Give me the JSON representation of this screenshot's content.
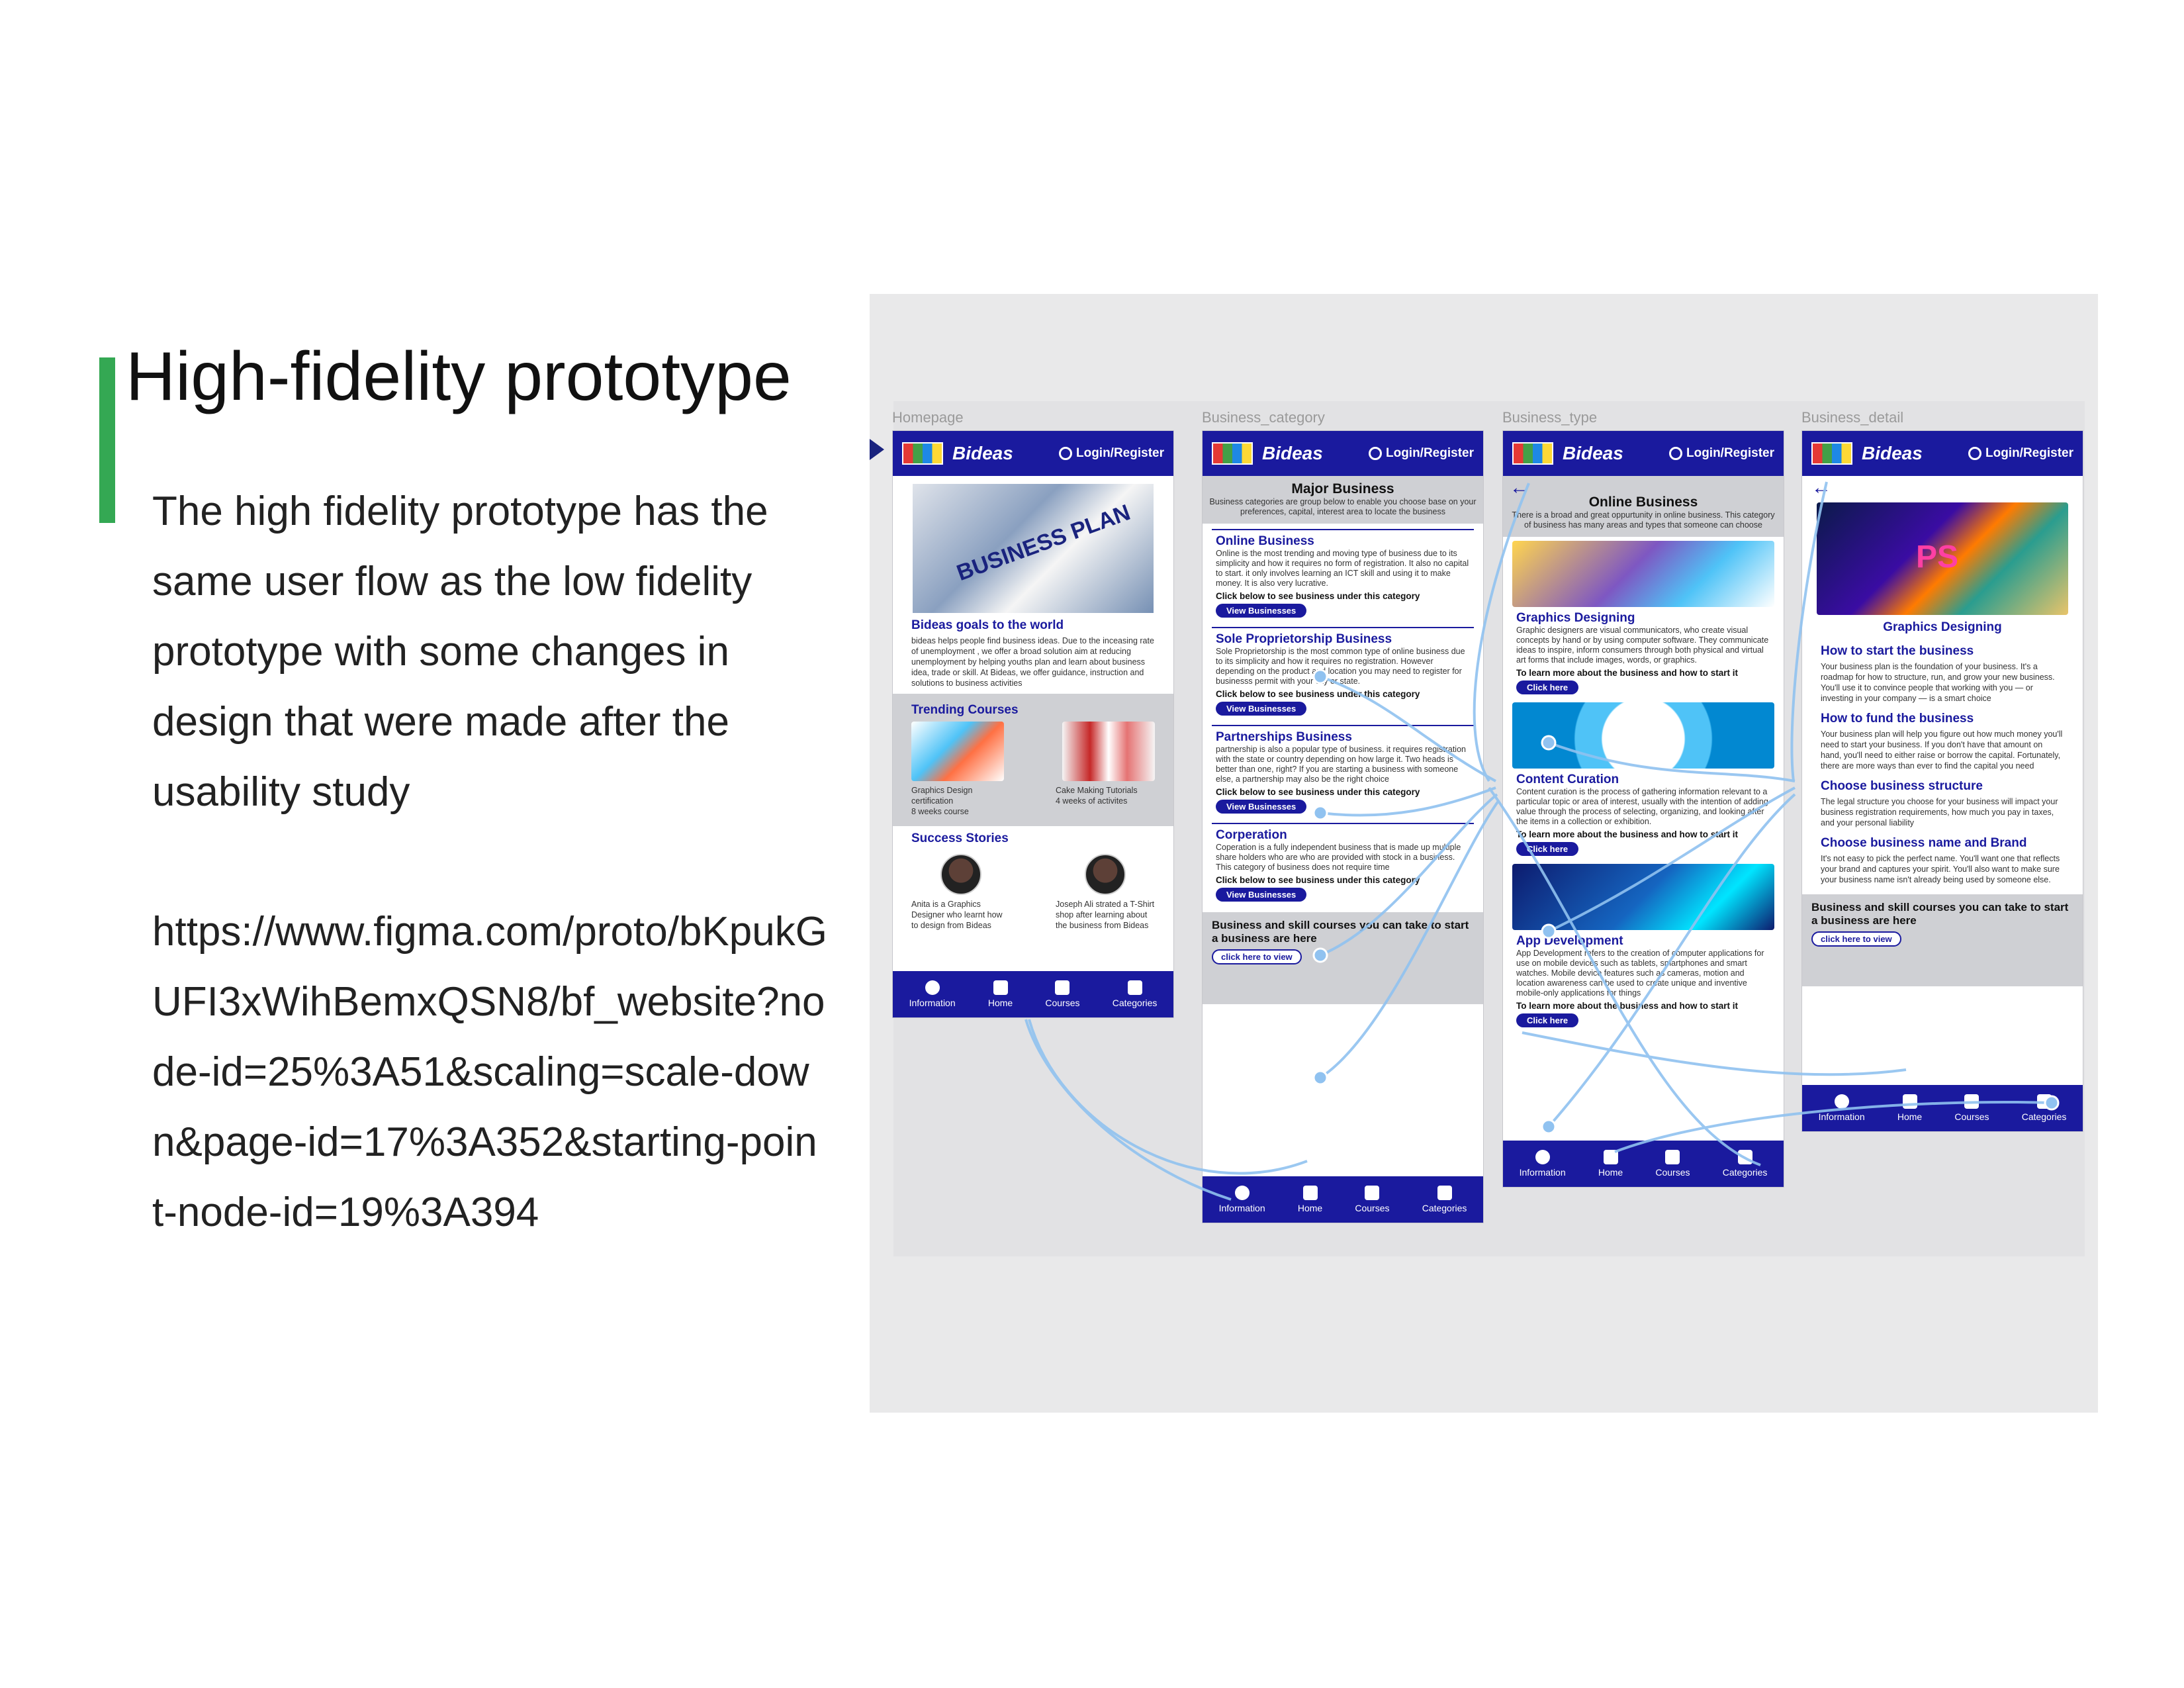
{
  "slide": {
    "title": "High-fidelity prototype",
    "body": "The high fidelity prototype has the same user flow as the low fidelity prototype with some changes in design that were made after the usability study",
    "link": "https://www.figma.com/proto/bKpukGUFI3xWihBemxQSN8/bf_website?node-id=25%3A51&scaling=scale-down&page-id=17%3A352&starting-point-node-id=19%3A394"
  },
  "colors": {
    "accent": "#34a853",
    "brand": "#1a1a9e",
    "canvas": "#e9e9ea"
  },
  "app": {
    "brand": "Bideas",
    "login": "Login/Register"
  },
  "frames": {
    "homepage": "Homepage",
    "business_category": "Business_category",
    "business_type": "Business_type",
    "business_detail": "Business_detail"
  },
  "tabbar": [
    "Information",
    "Home",
    "Courses",
    "Categories"
  ],
  "homepage": {
    "hero_text": "BUSINESS PLAN",
    "goals_title": "Bideas goals to the world",
    "goals_text": "bideas helps people find business ideas. Due to the inceasing rate of unemployment , we offer a broad solution aim at reducing unemployment by helping youths plan and learn about business idea, trade or skill. At Bideas, we offer guidance, instruction and solutions to business activities",
    "trending_title": "Trending Courses",
    "course1": "Graphics Design certification",
    "course1_meta": "8 weeks course",
    "course2": "Cake Making Tutorials",
    "course2_meta": "4 weeks of activites",
    "stories_title": "Success Stories",
    "story1": "Anita is a Graphics Designer who learnt how to design from Bideas",
    "story2": "Joseph Ali strated a T-Shirt shop after learning about the business from Bideas"
  },
  "category": {
    "title": "Major Business",
    "desc": "Business categories are group below to enable you choose base on your preferences, capital, interest area to locate the business",
    "cards": [
      {
        "title": "Online Business",
        "text": "Online is the most trending and moving type of business due to its simplicity and how it requires no form of registration. It also no capital to start. it only involves learning an ICT skill and using it to make money. It is also very lucrative."
      },
      {
        "title": "Sole Proprietorship Business",
        "text": "Sole Proprietorship is the most common type of online business due to its simplicity and how it requires no registration. However depending on the product and location you may need to register for businesss permit with your city or state."
      },
      {
        "title": "Partnerships Business",
        "text": "partnership is also a popular type of business. it requires registration with the state or country depending on how large it. Two heads is better than one, right? If you are starting a business with someone else, a partnership may also be the right choice"
      },
      {
        "title": "Corperation",
        "text": "Coperation is a fully independent business that is made up multiple share holders who are who are provided with stock in a business. This category of business does not require time"
      }
    ],
    "cta": "Click below to see  business under this category",
    "button": "View Businesses",
    "bottom_text": "Business and skill courses you can take to start a business are here",
    "bottom_button": "click here  to view"
  },
  "type": {
    "title": "Online Business",
    "desc": "There is a broad and great oppurtunity in online business. This category of business has many areas and types that someone can choose",
    "items": [
      {
        "title": "Graphics Designing",
        "text": "Graphic designers are visual communicators, who create visual concepts by hand or by using computer software. They communicate ideas to inspire, inform consumers through both physical and virtual art forms that include images, words, or graphics."
      },
      {
        "title": "Content Curation",
        "text": "Content curation is the process of gathering information relevant to a particular topic or area of interest, usually with the intention of adding value through the process of selecting, organizing, and looking after the items in a collection or exhibition."
      },
      {
        "title": "App Development",
        "text": "App Development refers to the creation of computer applications for use on mobile devices such as tablets, smartphones and smart watches. Mobile device features such as cameras, motion and location awareness can be used to create unique and inventive mobile-only applications for things"
      }
    ],
    "cta": "To learn more  about the business and how to start it",
    "button": "Click here"
  },
  "detail": {
    "image_text": "PS",
    "title": "Graphics Designing",
    "sections": [
      {
        "title": "How to start the business",
        "text": "Your business plan is the foundation of your business. It's a roadmap for how to structure, run, and grow your new business. You'll use it to convince people that working with you — or investing in your company — is a smart choice"
      },
      {
        "title": "How to fund the business",
        "text": "Your business plan will help you figure out how much money you'll need to start your business. If you don't have that amount on hand, you'll need to either raise or borrow the capital. Fortunately, there are more ways than ever to find the capital you need"
      },
      {
        "title": "Choose business structure",
        "text": "The legal structure you choose for your business will impact your business registration requirements, how much you pay in taxes, and your personal liability"
      },
      {
        "title": "Choose business name and Brand",
        "text": "It's not easy to pick the perfect name. You'll want one that reflects your brand and captures your spirit. You'll also want to make sure your business name isn't already being used by someone else."
      }
    ],
    "bottom_text": "Business and skill courses you can take to start a business are here",
    "bottom_button": "click here  to view"
  }
}
